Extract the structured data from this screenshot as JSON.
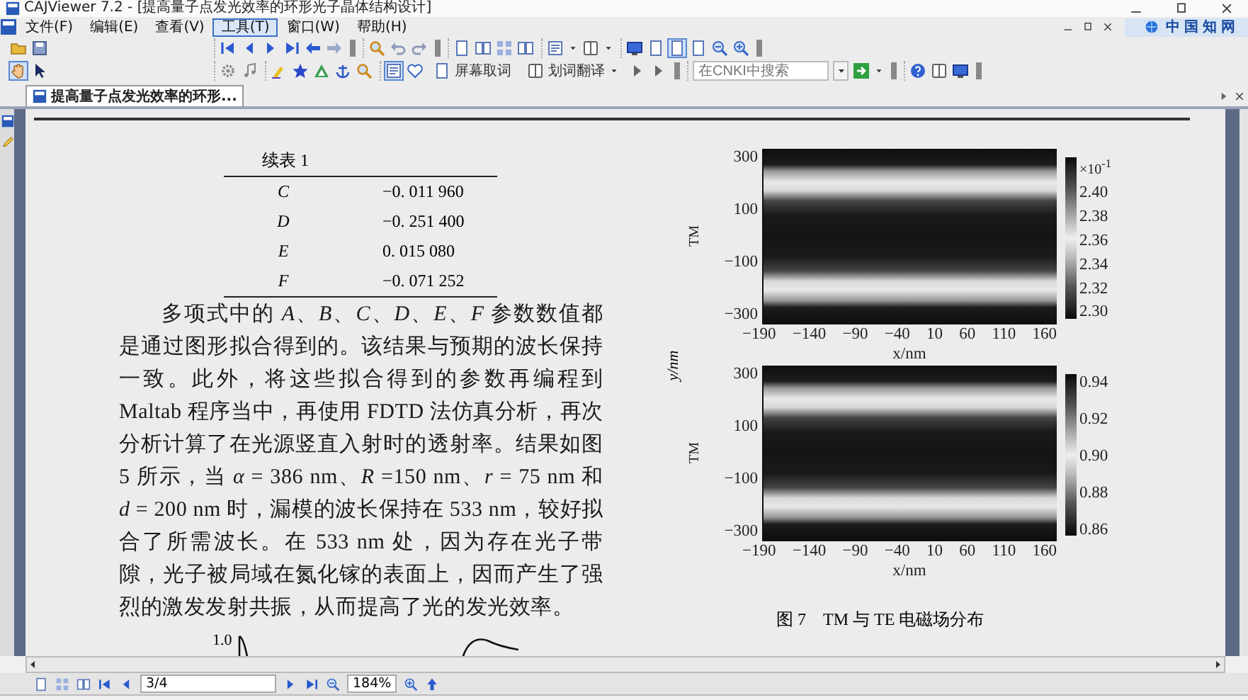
{
  "window": {
    "title": "CAJViewer 7.2 - [提高量子点发光效率的环形光子晶体结构设计]"
  },
  "menu": [
    {
      "label": "文件(F)",
      "selected": false
    },
    {
      "label": "编辑(E)",
      "selected": false
    },
    {
      "label": "查看(V)",
      "selected": false
    },
    {
      "label": "工具(T)",
      "selected": true
    },
    {
      "label": "窗口(W)",
      "selected": false
    },
    {
      "label": "帮助(H)",
      "selected": false
    }
  ],
  "brand": {
    "label": "中国知网"
  },
  "toolbar": {
    "screen_word_button": "屏幕取词",
    "translate_button": "划词翻译",
    "search": {
      "placeholder": "在CNKI中搜索"
    }
  },
  "tabs": [
    {
      "label": "提高量子点发光效率的环形...",
      "selected": true
    }
  ],
  "document": {
    "table": {
      "caption": "续表 1",
      "rows": [
        {
          "param": "C",
          "value": "−0. 011 960"
        },
        {
          "param": "D",
          "value": "−0. 251 400"
        },
        {
          "param": "E",
          "value": "0. 015 080"
        },
        {
          "param": "F",
          "value": "−0. 071 252"
        }
      ]
    },
    "paragraph": "多项式中的 *A*、*B*、*C*、*D*、*E*、*F* 参数数值都是通过图形拟合得到的。该结果与预期的波长保持一致。此外，将这些拟合得到的参数再编程到 Maltab 程序当中，再使用 FDTD 法仿真分析，再次分析计算了在光源竖直入射时的透射率。结果如图 5 所示，当 *α* = 386 nm、*R* =150 nm、*r* = 75 nm 和 *d* = 200 nm 时，漏模的波长保持在 533 nm，较好拟合了所需波长。在 533 nm 处，因为存在光子带隙，光子被局域在氮化镓的表面上，因而产生了强烈的激发发射共振，从而提高了光的发光效率。",
    "figure": {
      "y_label": "y/nm",
      "plots": [
        {
          "y_label": "TM",
          "y_ticks": [
            "300",
            "100",
            "−100",
            "−300"
          ],
          "x_ticks": [
            "−190",
            "−140",
            "−90",
            "−40",
            "10",
            "60",
            "110",
            "160"
          ],
          "x_label": "x/nm",
          "colorbar_exponent": "×10$^{-1}$",
          "colorbar_ticks": [
            "2.40",
            "2.38",
            "2.36",
            "2.34",
            "2.32",
            "2.30"
          ]
        },
        {
          "y_label": "TM",
          "y_ticks": [
            "300",
            "100",
            "−100",
            "−300"
          ],
          "x_ticks": [
            "−190",
            "−140",
            "−90",
            "−40",
            "10",
            "60",
            "110",
            "160"
          ],
          "x_label": "x/nm",
          "colorbar_ticks": [
            "0.94",
            "0.92",
            "0.90",
            "0.88",
            "0.86"
          ]
        }
      ],
      "caption": "图 7　TM 与 TE 电磁场分布"
    },
    "next_figure": {
      "y_tick": "1.0"
    }
  },
  "status_bar": {
    "page": "3/4",
    "zoom": "184%"
  }
}
